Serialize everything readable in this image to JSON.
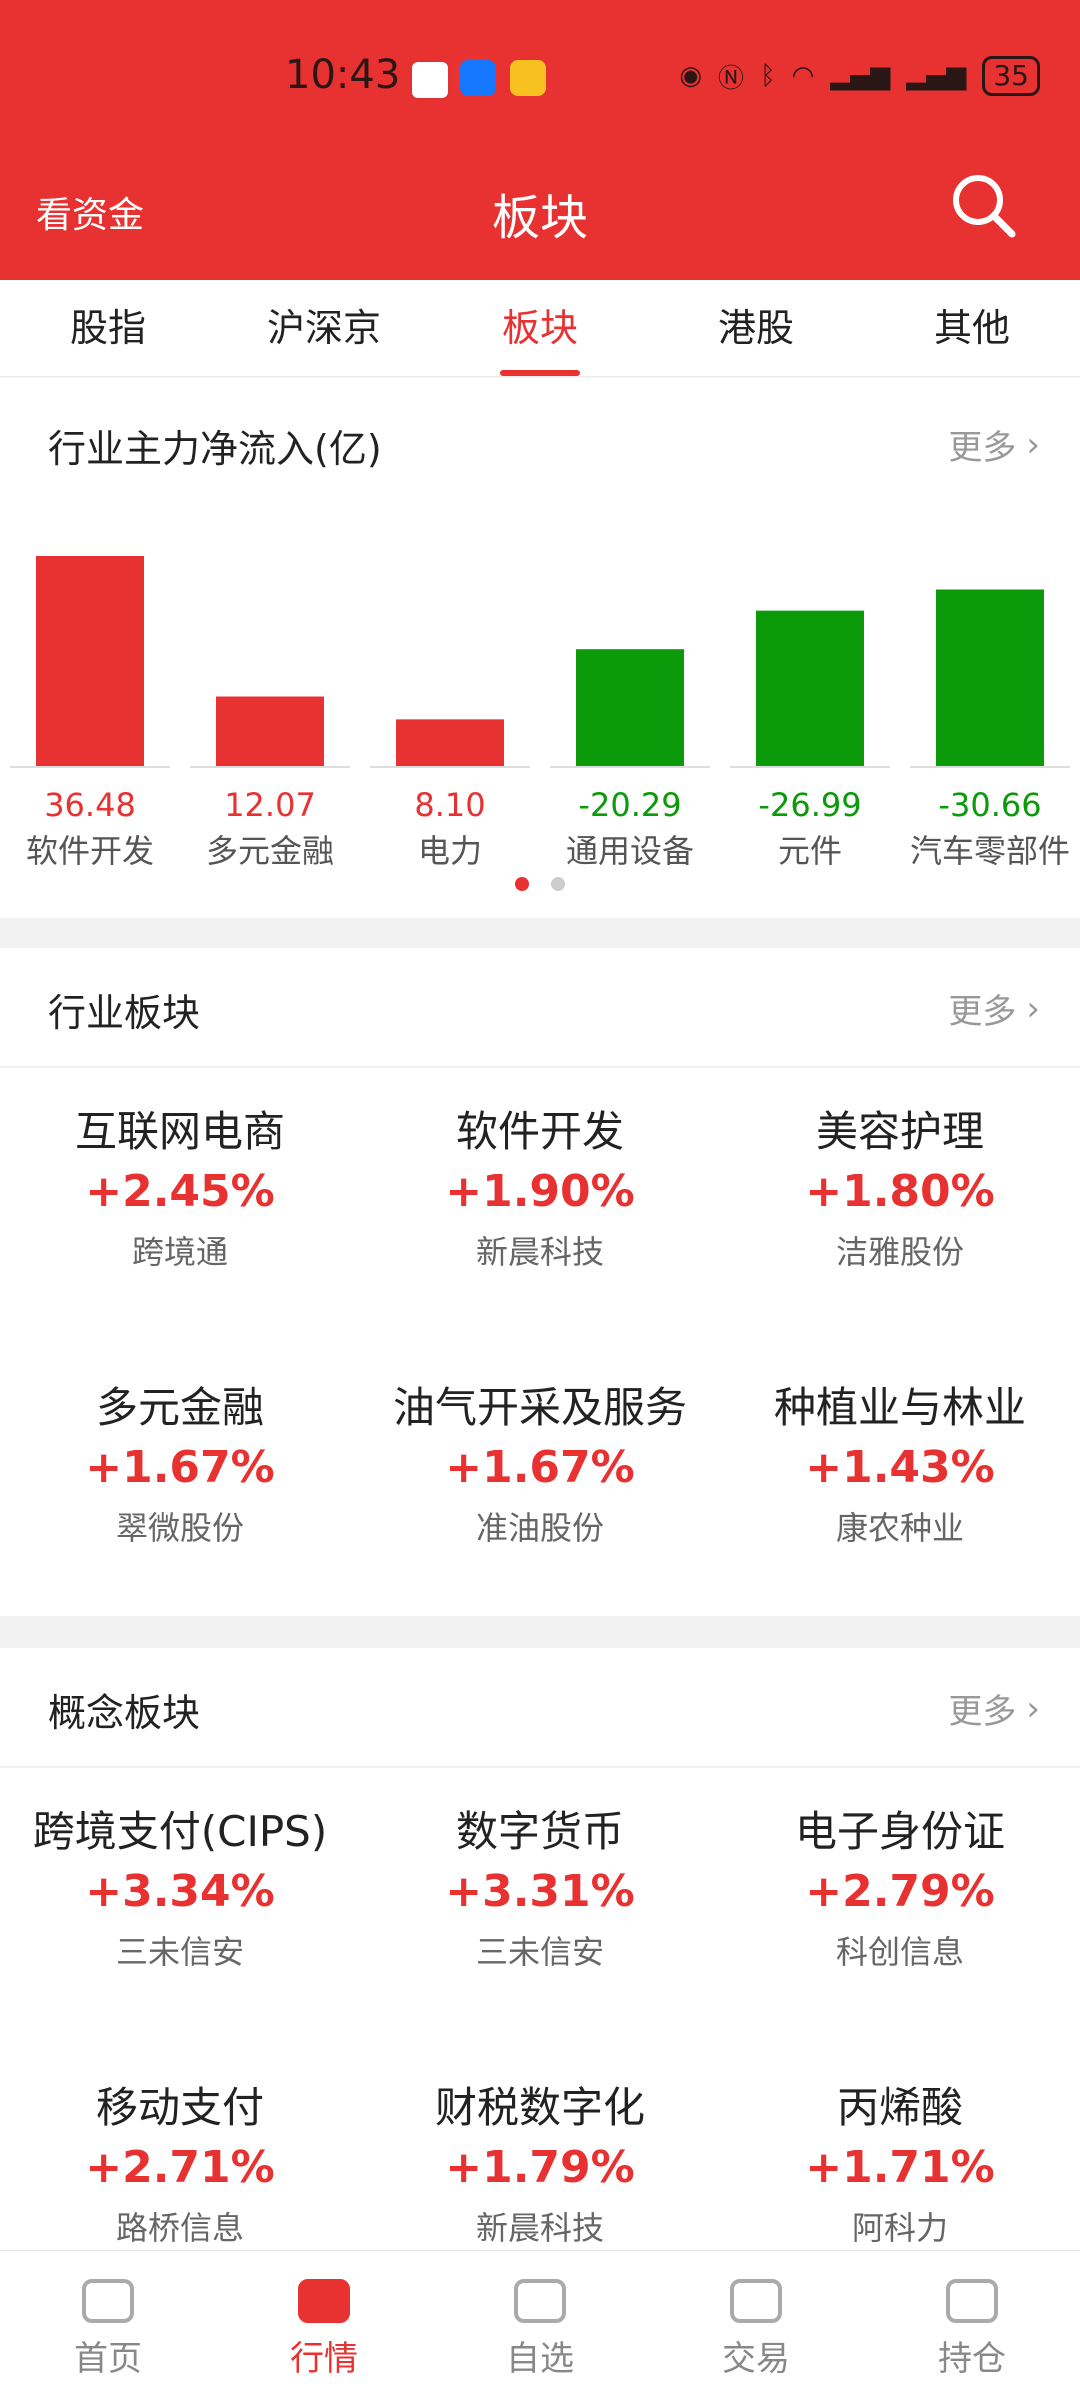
{
  "status": {
    "time": "10:43",
    "battery": "35"
  },
  "header": {
    "left_label": "看资金",
    "title": "板块"
  },
  "tabs": [
    {
      "label": "股指"
    },
    {
      "label": "沪深京"
    },
    {
      "label": "板块"
    },
    {
      "label": "港股"
    },
    {
      "label": "其他"
    }
  ],
  "net_inflow": {
    "title": "行业主力净流入(亿)",
    "more": "更多",
    "chart_data": {
      "type": "bar",
      "categories": [
        "软件开发",
        "多元金融",
        "电力",
        "通用设备",
        "元件",
        "汽车零部件"
      ],
      "values": [
        36.48,
        12.07,
        8.1,
        -20.29,
        -26.99,
        -30.66
      ],
      "value_labels": [
        "36.48",
        "12.07",
        "8.10",
        "-20.29",
        "-26.99",
        "-30.66"
      ],
      "colors": {
        "positive": "#e83131",
        "negative": "#0a9a0a"
      },
      "title": "行业主力净流入(亿)",
      "xlabel": "",
      "ylabel": ""
    }
  },
  "industry": {
    "title": "行业板块",
    "more": "更多",
    "items": [
      {
        "name": "互联网电商",
        "pct": "+2.45%",
        "lead": "跨境通"
      },
      {
        "name": "软件开发",
        "pct": "+1.90%",
        "lead": "新晨科技"
      },
      {
        "name": "美容护理",
        "pct": "+1.80%",
        "lead": "洁雅股份"
      },
      {
        "name": "多元金融",
        "pct": "+1.67%",
        "lead": "翠微股份"
      },
      {
        "name": "油气开采及服务",
        "pct": "+1.67%",
        "lead": "准油股份"
      },
      {
        "name": "种植业与林业",
        "pct": "+1.43%",
        "lead": "康农种业"
      }
    ]
  },
  "concept": {
    "title": "概念板块",
    "more": "更多",
    "items": [
      {
        "name": "跨境支付(CIPS)",
        "pct": "+3.34%",
        "lead": "三未信安"
      },
      {
        "name": "数字货币",
        "pct": "+3.31%",
        "lead": "三未信安"
      },
      {
        "name": "电子身份证",
        "pct": "+2.79%",
        "lead": "科创信息"
      },
      {
        "name": "移动支付",
        "pct": "+2.71%",
        "lead": "路桥信息"
      },
      {
        "name": "财税数字化",
        "pct": "+1.79%",
        "lead": "新晨科技"
      },
      {
        "name": "丙烯酸",
        "pct": "+1.71%",
        "lead": "阿科力"
      }
    ]
  },
  "bottom_nav": [
    {
      "label": "首页",
      "icon": "home-icon"
    },
    {
      "label": "行情",
      "icon": "market-icon"
    },
    {
      "label": "自选",
      "icon": "watchlist-icon"
    },
    {
      "label": "交易",
      "icon": "trade-icon"
    },
    {
      "label": "持仓",
      "icon": "wallet-icon"
    }
  ]
}
